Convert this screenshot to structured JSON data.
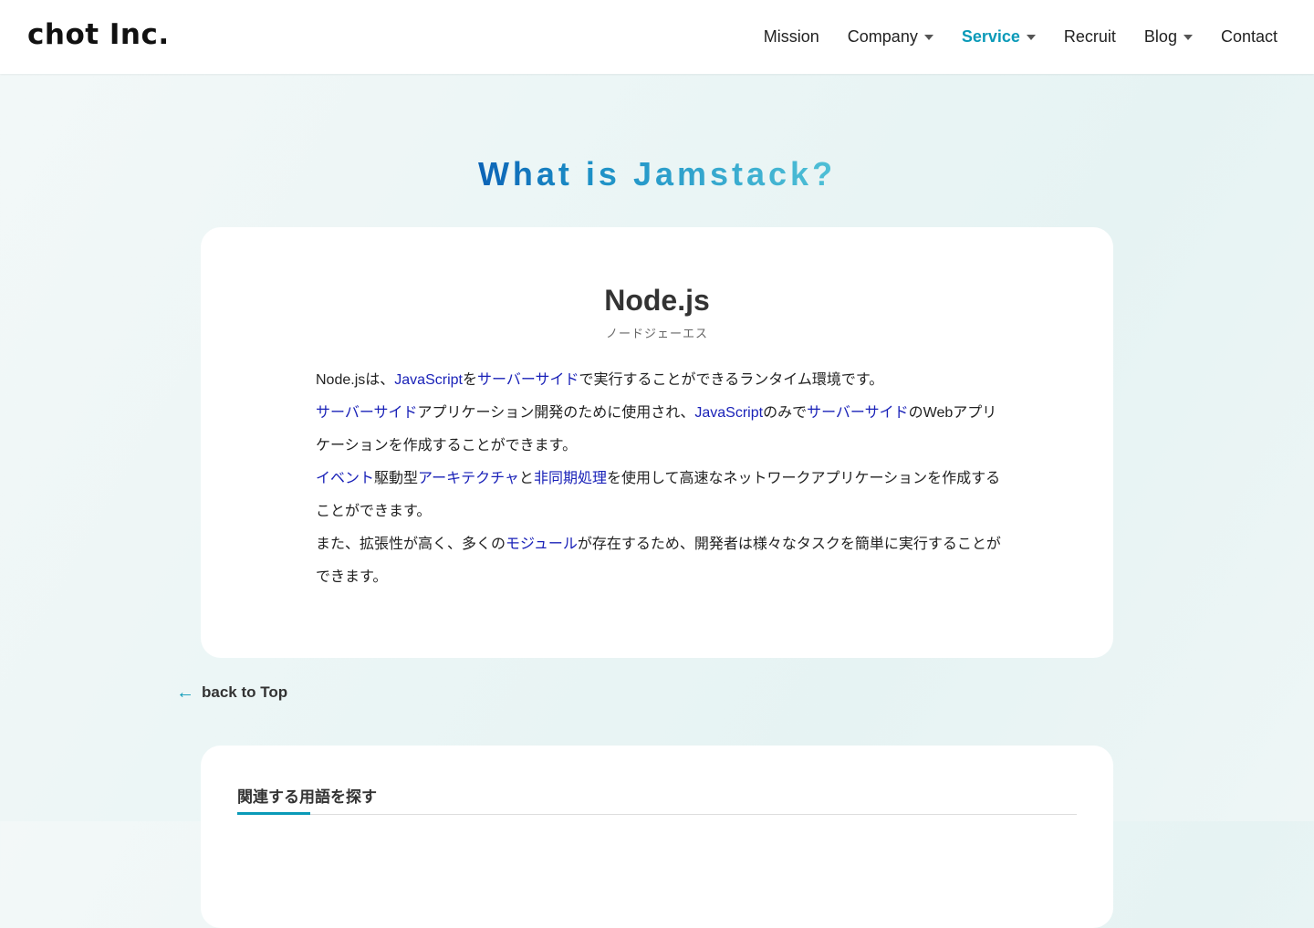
{
  "header": {
    "logo": "chot Inc.",
    "nav": [
      {
        "label": "Mission"
      },
      {
        "label": "Company",
        "dropdown": true
      },
      {
        "label": "Service",
        "dropdown": true,
        "active": true
      },
      {
        "label": "Recruit"
      },
      {
        "label": "Blog",
        "dropdown": true
      },
      {
        "label": "Contact"
      }
    ]
  },
  "hero": {
    "title": "What is Jamstack?"
  },
  "term": {
    "name": "Node.js",
    "reading": "ノードジェーエス",
    "paragraphs": [
      [
        {
          "t": "Node.jsは、"
        },
        {
          "t": "JavaScript",
          "link": true
        },
        {
          "t": "を"
        },
        {
          "t": "サーバーサイド",
          "link": true
        },
        {
          "t": "で実行することができるランタイム環境です。"
        }
      ],
      [
        {
          "t": "サーバーサイド",
          "link": true
        },
        {
          "t": "アプリケーション開発のために使用され、"
        },
        {
          "t": "JavaScript",
          "link": true
        },
        {
          "t": "のみで"
        },
        {
          "t": "サーバーサイド",
          "link": true
        },
        {
          "t": "のWebアプリケーションを作成することができます。"
        }
      ],
      [
        {
          "t": "イベント",
          "link": true
        },
        {
          "t": "駆動型"
        },
        {
          "t": "アーキテクチャ",
          "link": true
        },
        {
          "t": "と"
        },
        {
          "t": "非同期処理",
          "link": true
        },
        {
          "t": "を使用して高速なネットワークアプリケーションを作成することができます。"
        }
      ],
      [
        {
          "t": "また、拡張性が高く、多くの"
        },
        {
          "t": "モジュール",
          "link": true
        },
        {
          "t": "が存在するため、開発者は様々なタスクを簡単に実行することができます。"
        }
      ]
    ]
  },
  "back": {
    "label": "back to Top",
    "icon": "arrow-left-icon"
  },
  "related": {
    "title": "関連する用語を探す"
  },
  "colors": {
    "accent": "#0a9ab8",
    "link": "#1a22b8",
    "title_gradient": [
      "#0c63b6",
      "#4fc0d6"
    ]
  }
}
